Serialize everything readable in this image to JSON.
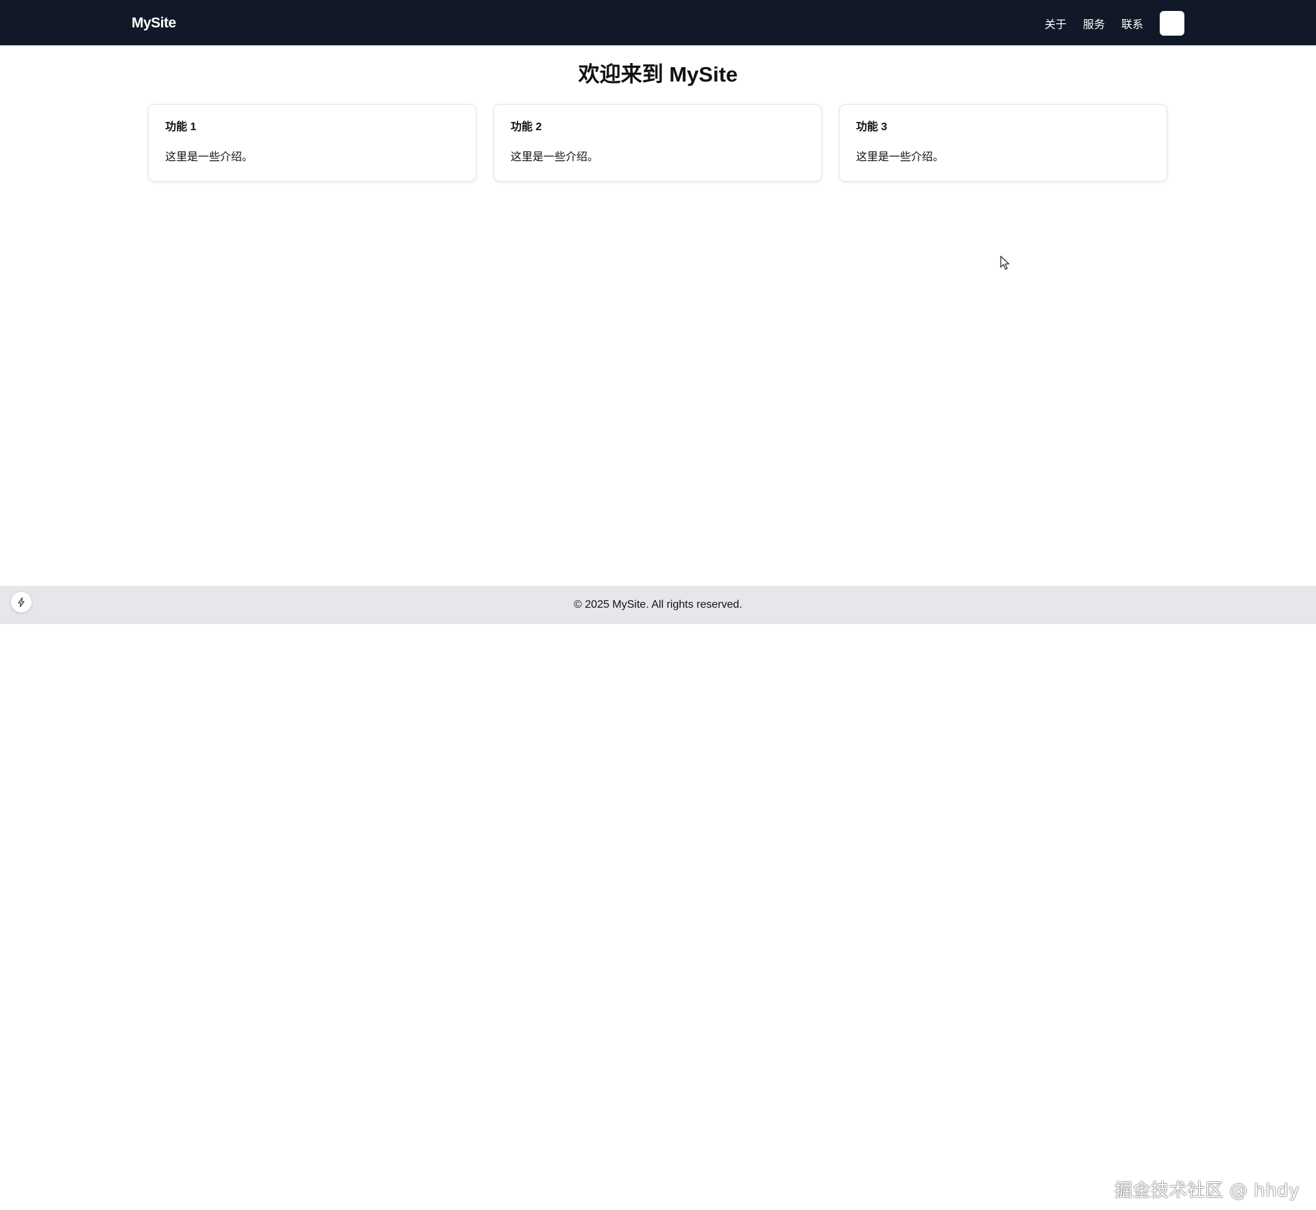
{
  "header": {
    "brand": "MySite",
    "nav": [
      {
        "label": "关于"
      },
      {
        "label": "服务"
      },
      {
        "label": "联系"
      }
    ]
  },
  "main": {
    "title": "欢迎来到 MySite",
    "cards": [
      {
        "title": "功能 1",
        "text": "这里是一些介绍。"
      },
      {
        "title": "功能 2",
        "text": "这里是一些介绍。"
      },
      {
        "title": "功能 3",
        "text": "这里是一些介绍。"
      }
    ]
  },
  "footer": {
    "text": "© 2025 MySite. All rights reserved."
  },
  "watermark": "掘金技术社区 @ hhdy",
  "icons": {
    "floating_button": "bolt-icon",
    "cursor": "mouse-cursor-icon"
  },
  "colors": {
    "navbar_bg": "#111827",
    "footer_bg": "#e5e7eb",
    "card_border": "#e5e7eb"
  }
}
